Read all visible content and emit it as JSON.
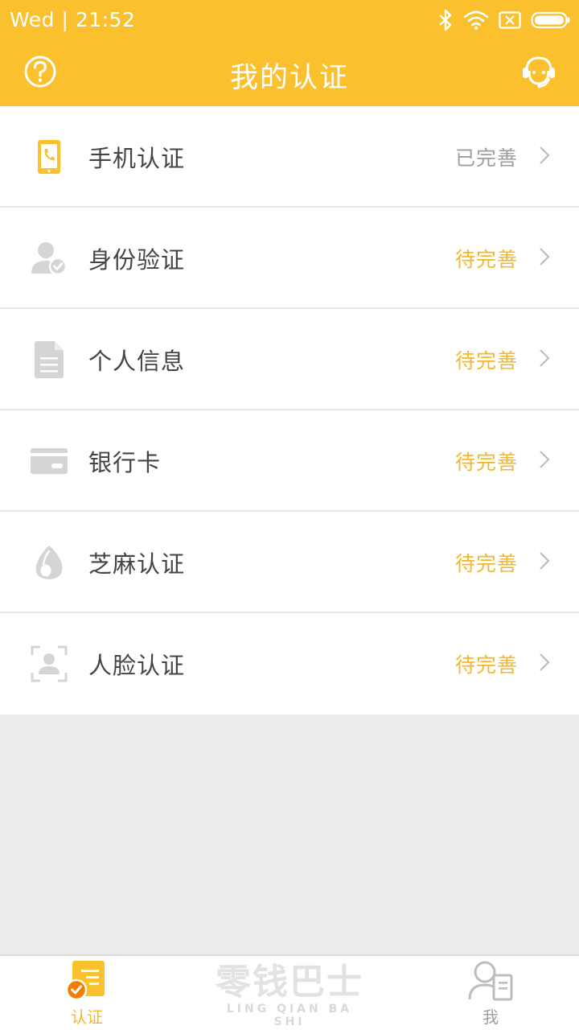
{
  "status_bar": {
    "time": "Wed | 21:52"
  },
  "header": {
    "title": "我的认证"
  },
  "items": [
    {
      "label": "手机认证",
      "status": "已完善",
      "icon": "phone-icon"
    },
    {
      "label": "身份验证",
      "status": "待完善",
      "icon": "user-check-icon"
    },
    {
      "label": "个人信息",
      "status": "待完善",
      "icon": "document-icon"
    },
    {
      "label": "银行卡",
      "status": "待完善",
      "icon": "bank-card-icon"
    },
    {
      "label": "芝麻认证",
      "status": "待完善",
      "icon": "sesame-icon"
    },
    {
      "label": "人脸认证",
      "status": "待完善",
      "icon": "face-scan-icon"
    }
  ],
  "tabbar": {
    "auth_label": "认证",
    "me_label": "我",
    "brand_cn": "零钱巴士",
    "brand_en": "LING QIAN BA SHI"
  },
  "colors": {
    "accent": "#fbc02d",
    "pending": "#f5b62a",
    "done": "#9e9e9e",
    "badge": "#f57c00"
  }
}
